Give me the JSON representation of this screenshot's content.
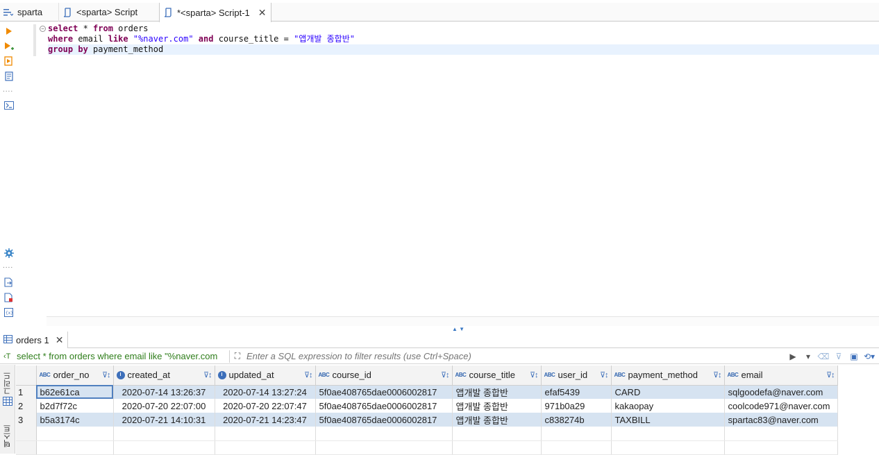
{
  "tabs": [
    {
      "label": "sparta",
      "icon": "database-tree-icon"
    },
    {
      "label": "<sparta> Script",
      "icon": "sql-script-icon"
    },
    {
      "label": "*<sparta> Script-1",
      "icon": "sql-script-icon",
      "active": true
    }
  ],
  "editor": {
    "lines": [
      [
        {
          "t": "kw",
          "v": "select"
        },
        {
          "t": "ident",
          "v": " * "
        },
        {
          "t": "kw",
          "v": "from"
        },
        {
          "t": "ident",
          "v": " orders"
        }
      ],
      [
        {
          "t": "kw",
          "v": "where"
        },
        {
          "t": "ident",
          "v": " email "
        },
        {
          "t": "kw",
          "v": "like"
        },
        {
          "t": "ident",
          "v": " "
        },
        {
          "t": "str",
          "v": "\"%naver.com\""
        },
        {
          "t": "ident",
          "v": " "
        },
        {
          "t": "kw",
          "v": "and"
        },
        {
          "t": "ident",
          "v": " course_title = "
        },
        {
          "t": "str",
          "v": "\"앱개발 종합반\""
        }
      ],
      [
        {
          "t": "kw",
          "v": "group"
        },
        {
          "t": "ident",
          "v": " "
        },
        {
          "t": "kw",
          "v": "by"
        },
        {
          "t": "ident",
          "v": " payment_method"
        }
      ]
    ]
  },
  "results": {
    "tab_label": "orders 1",
    "query_text": "select * from orders where email like \"%naver.com",
    "filter_placeholder": "Enter a SQL expression to filter results (use Ctrl+Space)",
    "side_tabs": [
      "그리드",
      "텍스트"
    ],
    "columns": [
      {
        "name": "order_no",
        "type": "ABC"
      },
      {
        "name": "created_at",
        "type": "datetime"
      },
      {
        "name": "updated_at",
        "type": "datetime"
      },
      {
        "name": "course_id",
        "type": "ABC"
      },
      {
        "name": "course_title",
        "type": "ABC"
      },
      {
        "name": "user_id",
        "type": "ABC"
      },
      {
        "name": "payment_method",
        "type": "ABC"
      },
      {
        "name": "email",
        "type": "ABC"
      }
    ],
    "rows": [
      [
        "1",
        "b62e61ca",
        "2020-07-14 13:26:37",
        "2020-07-14 13:27:24",
        "5f0ae408765dae0006002817",
        "앱개발 종합반",
        "efaf5439",
        "CARD",
        "sqlgoodefa@naver.com"
      ],
      [
        "2",
        "b2d7f72c",
        "2020-07-20 22:07:00",
        "2020-07-20 22:07:47",
        "5f0ae408765dae0006002817",
        "앱개발 종합반",
        "971b0a29",
        "kakaopay",
        "coolcode971@naver.com"
      ],
      [
        "3",
        "b5a3174c",
        "2020-07-21 14:10:31",
        "2020-07-21 14:23:47",
        "5f0ae408765dae0006002817",
        "앱개발 종합반",
        "c838274b",
        "TAXBILL",
        "spartac83@naver.com"
      ]
    ]
  },
  "colors": {
    "keyword": "#7f0055",
    "string": "#2a00ff",
    "selected_row": "#d6e3f1",
    "query_green": "#2e7d1a"
  }
}
